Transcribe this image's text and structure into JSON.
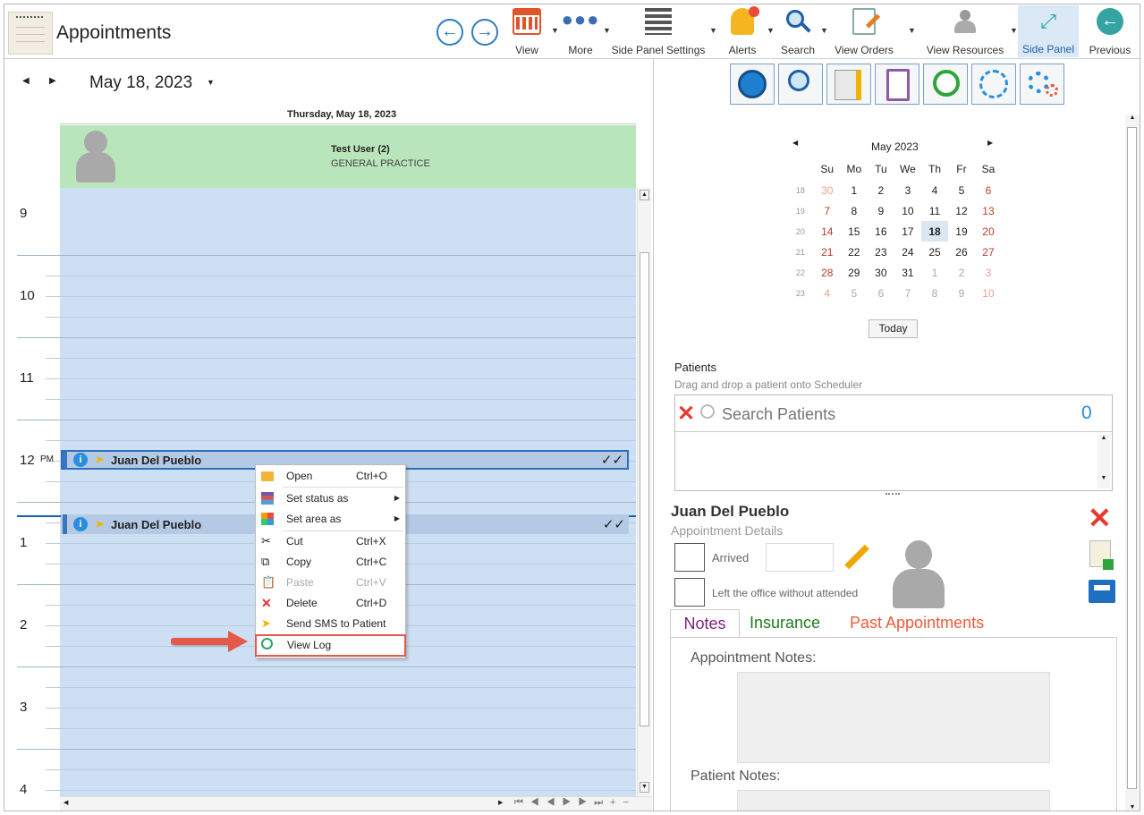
{
  "app": {
    "title": "Appointments"
  },
  "toolbar": {
    "view": "View",
    "more": "More",
    "side_panel_settings": "Side Panel Settings",
    "alerts": "Alerts",
    "search": "Search",
    "view_orders": "View Orders",
    "view_resources": "View Resources",
    "side_panel": "Side Panel",
    "previous": "Previous"
  },
  "scheduler": {
    "date": "May 18, 2023",
    "day_header": "Thursday, May 18, 2023",
    "resource_name": "Test User (2)",
    "resource_sub": "GENERAL PRACTICE",
    "hours": [
      "9",
      "10",
      "11",
      "12",
      "1",
      "2",
      "3",
      "4"
    ],
    "pm": "PM",
    "appointments": [
      {
        "name": "Juan Del Pueblo",
        "status": "✓✓"
      },
      {
        "name": "Juan Del Pueblo",
        "status": "✓✓"
      }
    ]
  },
  "context_menu": {
    "items": [
      {
        "label": "Open",
        "shortcut": "Ctrl+O"
      },
      {
        "label": "Set status as",
        "shortcut": ""
      },
      {
        "label": "Set area as",
        "shortcut": ""
      },
      {
        "label": "Cut",
        "shortcut": "Ctrl+X"
      },
      {
        "label": "Copy",
        "shortcut": "Ctrl+C"
      },
      {
        "label": "Paste",
        "shortcut": "Ctrl+V"
      },
      {
        "label": "Delete",
        "shortcut": "Ctrl+D"
      },
      {
        "label": "Send SMS to Patient",
        "shortcut": ""
      },
      {
        "label": "View Log",
        "shortcut": ""
      }
    ]
  },
  "mini_calendar": {
    "month": "May 2023",
    "days": [
      "Su",
      "Mo",
      "Tu",
      "We",
      "Th",
      "Fr",
      "Sa"
    ],
    "weeks": [
      [
        "18",
        "30",
        "1",
        "2",
        "3",
        "4",
        "5",
        "6"
      ],
      [
        "19",
        "7",
        "8",
        "9",
        "10",
        "11",
        "12",
        "13"
      ],
      [
        "20",
        "14",
        "15",
        "16",
        "17",
        "18",
        "19",
        "20"
      ],
      [
        "21",
        "21",
        "22",
        "23",
        "24",
        "25",
        "26",
        "27"
      ],
      [
        "22",
        "28",
        "29",
        "30",
        "31",
        "1",
        "2",
        "3"
      ],
      [
        "23",
        "4",
        "5",
        "6",
        "7",
        "8",
        "9",
        "10"
      ]
    ],
    "today": "Today"
  },
  "patients": {
    "title": "Patients",
    "hint": "Drag and drop a patient onto Scheduler",
    "search_placeholder": "Search Patients",
    "count": "0"
  },
  "details": {
    "name": "Juan Del Pueblo",
    "subtitle": "Appointment Details",
    "arrived": "Arrived",
    "left_office": "Left the office without attended",
    "tabs": [
      "Notes",
      "Insurance",
      "Past Appointments"
    ],
    "appointment_notes": "Appointment Notes:",
    "patient_notes": "Patient Notes:"
  },
  "colors": {
    "accent": "#1e78c8",
    "resource_bg": "#b9e5bb",
    "grid_bg": "#cddff2",
    "highlight": "#e74c3c"
  }
}
